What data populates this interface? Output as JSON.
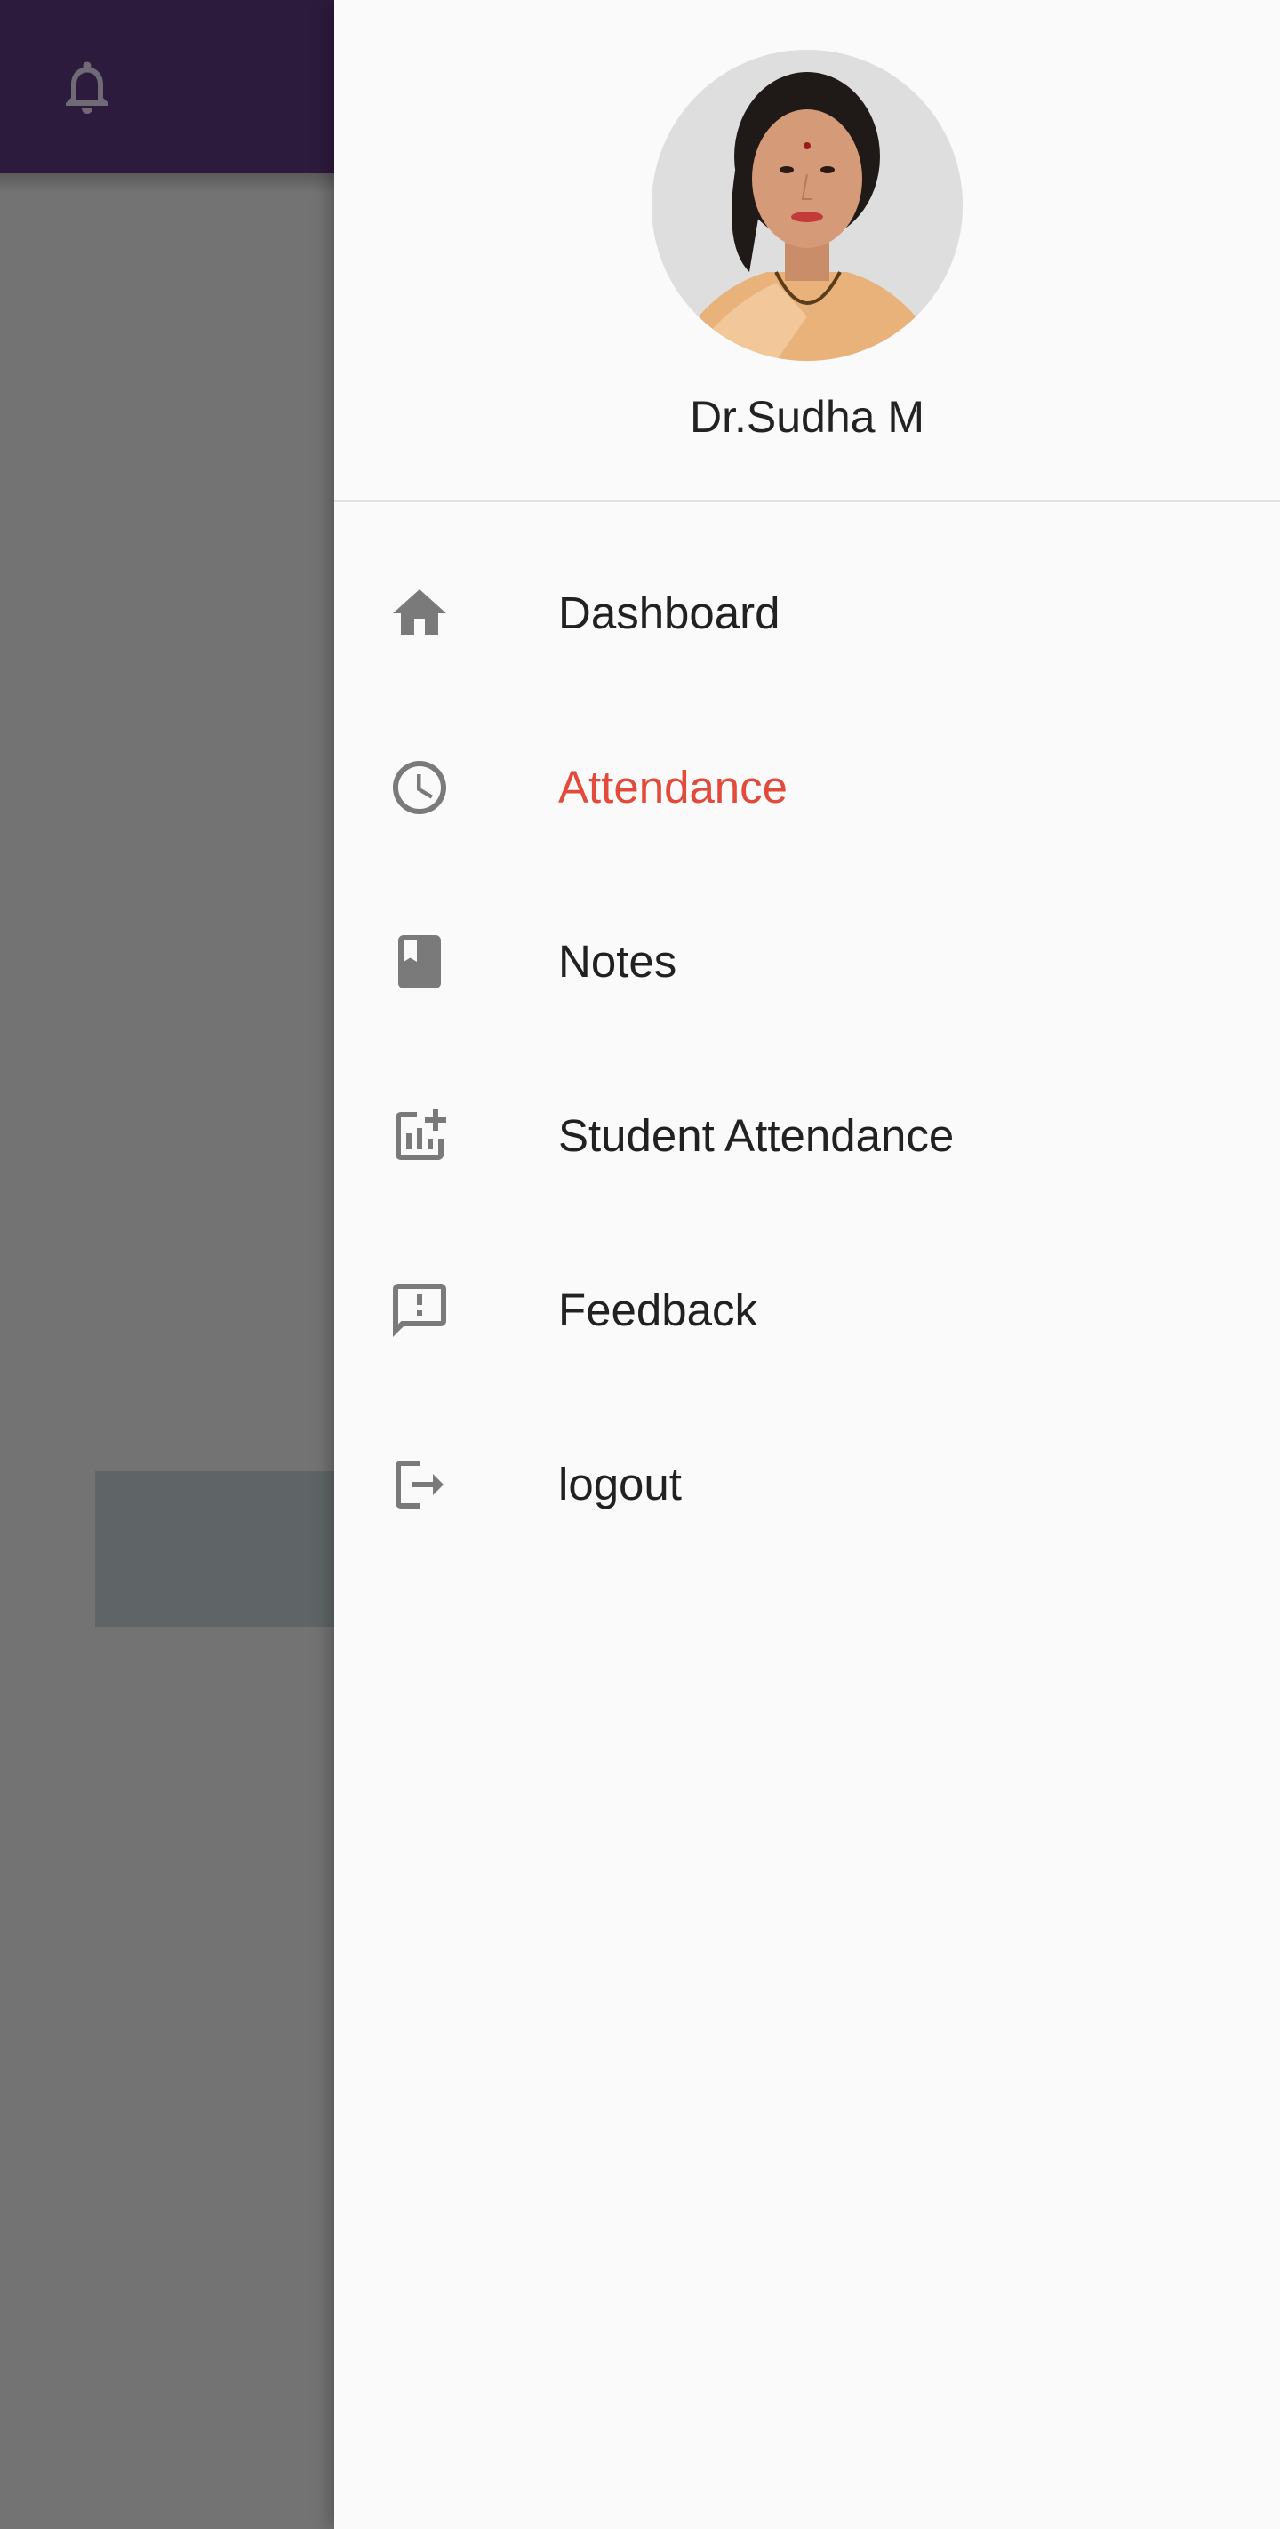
{
  "user": {
    "name": "Dr.Sudha M"
  },
  "menu": {
    "items": [
      {
        "label": "Dashboard",
        "icon": "home-icon",
        "active": false
      },
      {
        "label": "Attendance",
        "icon": "clock-icon",
        "active": true
      },
      {
        "label": "Notes",
        "icon": "book-icon",
        "active": false
      },
      {
        "label": "Student Attendance",
        "icon": "chart-add-icon",
        "active": false
      },
      {
        "label": "Feedback",
        "icon": "feedback-icon",
        "active": false
      },
      {
        "label": "logout",
        "icon": "logout-icon",
        "active": false
      }
    ]
  },
  "colors": {
    "app_bar": "#2d1b3d",
    "active_text": "#e24a3b",
    "icon": "#7a7a7a",
    "scrim": "#737373"
  }
}
